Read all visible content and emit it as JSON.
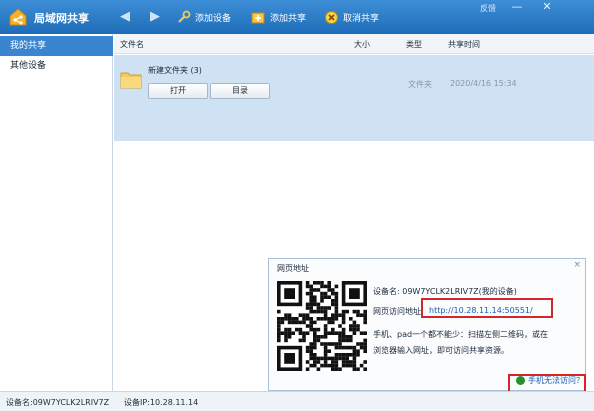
{
  "app": {
    "title": "局域网共享",
    "feedback": "反馈"
  },
  "toolbar": {
    "add_device": "添加设备",
    "add_share": "添加共享",
    "cancel_share": "取消共享"
  },
  "window": {
    "minimize": "—",
    "close": "✕"
  },
  "sidebar": {
    "items": [
      {
        "label": "我的共享",
        "active": true
      },
      {
        "label": "其他设备",
        "active": false
      }
    ]
  },
  "columns": {
    "name": "文件名",
    "size": "大小",
    "type": "类型",
    "time": "共享时间"
  },
  "rows": [
    {
      "name": "新建文件夹 (3)",
      "size": "",
      "type": "文件夹",
      "time": "2020/4/16 15:34",
      "open_label": "打开",
      "dir_label": "目录"
    }
  ],
  "popup": {
    "title": "网页地址",
    "device_name": "设备名: 09W7YCLK2LRIV7Z(我的设备)",
    "url_label": "网页访问地址:",
    "url": "http://10.28.11.14:50551/",
    "desc_line1": "手机、pad一个都不能少：扫描左侧二维码，或在",
    "desc_line2": "浏览器输入网址，即可访问共享资源。",
    "help_link": "手机无法访问？"
  },
  "statusbar": {
    "device_name": "设备名:09W7YCLK2LRIV7Z",
    "device_ip": "设备IP:10.28.11.14"
  },
  "colors": {
    "titlebar": "#2677c4",
    "selection": "#cfe2f4",
    "highlight": "#d5262b",
    "link": "#1a5fb4"
  },
  "icons": [
    "app-logo-icon",
    "back-arrow-icon",
    "forward-arrow-icon",
    "add-device-icon",
    "add-share-icon",
    "cancel-share-icon",
    "folder-icon",
    "qr-code",
    "close-icon",
    "help-icon"
  ]
}
